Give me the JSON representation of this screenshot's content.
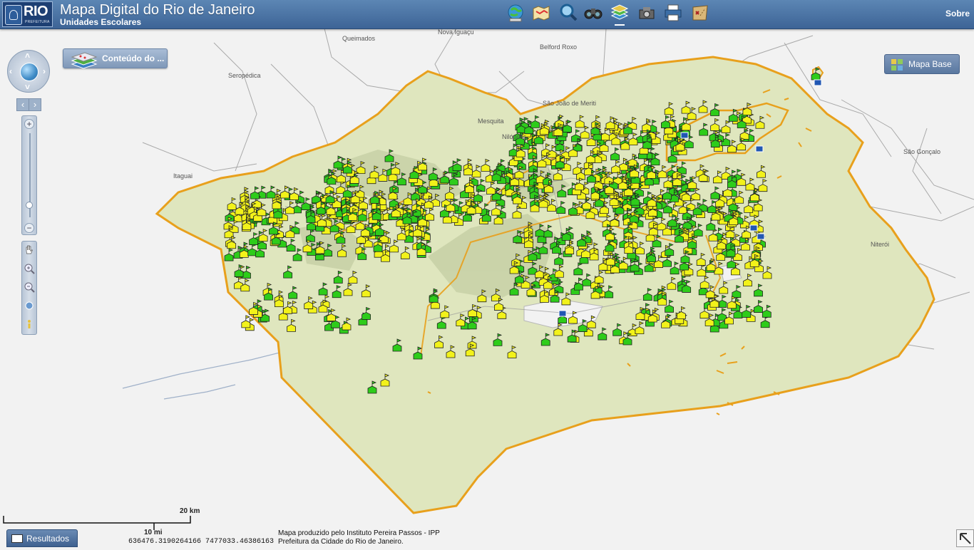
{
  "header": {
    "logo_text": "RIO",
    "logo_subtext": "PREFEITURA",
    "title": "Mapa Digital do Rio de Janeiro",
    "subtitle": "Unidades Escolares",
    "about_link": "Sobre"
  },
  "toolbar": {
    "tools": [
      {
        "icon": "globe-search-icon",
        "active": false
      },
      {
        "icon": "map-icon",
        "active": false
      },
      {
        "icon": "search-icon",
        "active": false
      },
      {
        "icon": "binoculars-icon",
        "active": false
      },
      {
        "icon": "layers-icon",
        "active": true
      },
      {
        "icon": "tools-icon",
        "active": false
      },
      {
        "icon": "print-icon",
        "active": false
      },
      {
        "icon": "treasure-map-icon",
        "active": false
      }
    ]
  },
  "map": {
    "place_labels": [
      "Nova Iguaçu",
      "Queimados",
      "Belford Roxo",
      "Seropédica",
      "São João de Meriti",
      "Mesquita",
      "Nilópolis",
      "Itaguai",
      "São Gonçalo",
      "Niterói"
    ],
    "layer_panel_button": "Conteúdo do ...",
    "basemap_button": "Mapa Base",
    "marker_colors": {
      "green": "#2ecc1a",
      "yellow": "#f2f21a",
      "boundary": "#e8a01c",
      "land": "#dfe6be"
    }
  },
  "footer": {
    "scale_km": "20 km",
    "scale_mi": "10 mi",
    "coordinates": "636476.3190264166 7477033.46386163",
    "credit_line1": "Mapa produzido pelo Instituto Pereira Passos - IPP",
    "credit_line2": "Prefeitura da Cidade do Rio de Janeiro.",
    "results_button": "Resultados"
  }
}
